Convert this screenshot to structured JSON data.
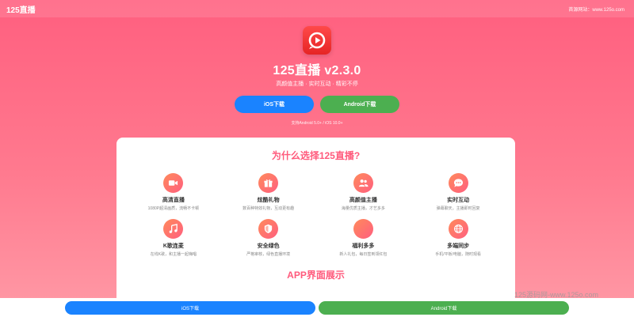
{
  "topbar": {
    "brand": "125直播",
    "site_note": "首源网站：www.125o.com"
  },
  "hero": {
    "app_title": "125直播 v2.3.0",
    "subtitle": "高颜值主播 · 实时互动 · 精彩不停",
    "ios_button": "iOS下载",
    "android_button": "Android下载",
    "support": "支持Android 5.0+ / iOS 10.0+"
  },
  "why": {
    "title": "为什么选择125直播?",
    "features": [
      {
        "icon": "video-camera-icon",
        "title": "高清直播",
        "desc": "1080P超清画质，流畅不卡顿"
      },
      {
        "icon": "gift-icon",
        "title": "炫酷礼物",
        "desc": "数百种特效礼物，互动更有趣"
      },
      {
        "icon": "users-icon",
        "title": "高颜值主播",
        "desc": "海量优质主播，才艺多多"
      },
      {
        "icon": "chat-bubble-icon",
        "title": "实时互动",
        "desc": "弹幕聊天，主播即时回复"
      },
      {
        "icon": "music-note-icon",
        "title": "K歌连麦",
        "desc": "在线K歌，和主播一起嗨唱"
      },
      {
        "icon": "shield-icon",
        "title": "安全绿色",
        "desc": "严格审核，绿色直播环境"
      },
      {
        "icon": "badge-icon",
        "title": "福利多多",
        "desc": "新人礼包，每日签到领红包"
      },
      {
        "icon": "globe-icon",
        "title": "多端同步",
        "desc": "手机/平板/电脑，随时观看"
      }
    ]
  },
  "screens": {
    "title": "APP界面展示"
  },
  "watermark": "125源码网-www.125o.com",
  "bottom": {
    "ios_button": "iOS下载",
    "android_button": "Android下载"
  },
  "colors": {
    "accent": "#ff5a7c",
    "ios": "#1a83ff",
    "android": "#4caf50"
  }
}
